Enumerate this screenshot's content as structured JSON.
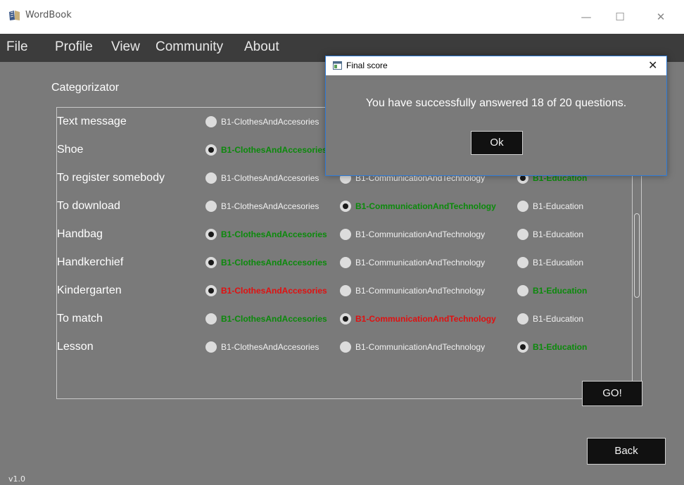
{
  "window": {
    "title": "WordBook",
    "minimize": "—",
    "maximize": "☐",
    "close": "✕"
  },
  "menu": [
    "File",
    "Profile",
    "View",
    "Community",
    "About"
  ],
  "section_title": "Categorizator",
  "categories": [
    "B1-ClothesAndAccesories",
    "B1-CommunicationAndTechnology",
    "B1-Education"
  ],
  "rows": [
    {
      "word": "Text message",
      "options": [
        {
          "label": "B1-ClothesAndAccesories",
          "selected": false,
          "state": "normal"
        },
        {
          "label": "B1-CommunicationAndTechnology",
          "selected": false,
          "state": "normal"
        },
        {
          "label": "B1-Education",
          "selected": false,
          "state": "normal"
        }
      ]
    },
    {
      "word": "Shoe",
      "options": [
        {
          "label": "B1-ClothesAndAccesories",
          "selected": true,
          "state": "correct"
        },
        {
          "label": "B1-CommunicationAndTechnology",
          "selected": false,
          "state": "normal"
        },
        {
          "label": "B1-Education",
          "selected": false,
          "state": "normal"
        }
      ]
    },
    {
      "word": "To register somebody",
      "options": [
        {
          "label": "B1-ClothesAndAccesories",
          "selected": false,
          "state": "normal"
        },
        {
          "label": "B1-CommunicationAndTechnology",
          "selected": false,
          "state": "normal"
        },
        {
          "label": "B1-Education",
          "selected": true,
          "state": "correct"
        }
      ]
    },
    {
      "word": "To download",
      "options": [
        {
          "label": "B1-ClothesAndAccesories",
          "selected": false,
          "state": "normal"
        },
        {
          "label": "B1-CommunicationAndTechnology",
          "selected": true,
          "state": "correct"
        },
        {
          "label": "B1-Education",
          "selected": false,
          "state": "normal"
        }
      ]
    },
    {
      "word": "Handbag",
      "options": [
        {
          "label": "B1-ClothesAndAccesories",
          "selected": true,
          "state": "correct"
        },
        {
          "label": "B1-CommunicationAndTechnology",
          "selected": false,
          "state": "normal"
        },
        {
          "label": "B1-Education",
          "selected": false,
          "state": "normal"
        }
      ]
    },
    {
      "word": "Handkerchief",
      "options": [
        {
          "label": "B1-ClothesAndAccesories",
          "selected": true,
          "state": "correct"
        },
        {
          "label": "B1-CommunicationAndTechnology",
          "selected": false,
          "state": "normal"
        },
        {
          "label": "B1-Education",
          "selected": false,
          "state": "normal"
        }
      ]
    },
    {
      "word": "Kindergarten",
      "options": [
        {
          "label": "B1-ClothesAndAccesories",
          "selected": true,
          "state": "wrong"
        },
        {
          "label": "B1-CommunicationAndTechnology",
          "selected": false,
          "state": "normal"
        },
        {
          "label": "B1-Education",
          "selected": false,
          "state": "correct"
        }
      ]
    },
    {
      "word": "To match",
      "options": [
        {
          "label": "B1-ClothesAndAccesories",
          "selected": false,
          "state": "correct"
        },
        {
          "label": "B1-CommunicationAndTechnology",
          "selected": true,
          "state": "wrong"
        },
        {
          "label": "B1-Education",
          "selected": false,
          "state": "normal"
        }
      ]
    },
    {
      "word": "Lesson",
      "options": [
        {
          "label": "B1-ClothesAndAccesories",
          "selected": false,
          "state": "normal"
        },
        {
          "label": "B1-CommunicationAndTechnology",
          "selected": false,
          "state": "normal"
        },
        {
          "label": "B1-Education",
          "selected": true,
          "state": "correct"
        }
      ]
    }
  ],
  "go_button": "GO!",
  "back_button": "Back",
  "version": "v1.0",
  "dialog": {
    "title": "Final score",
    "close": "✕",
    "message": "You have successfully answered 18 of 20 questions.",
    "ok_button": "Ok"
  },
  "colors": {
    "correct": "#0b8a0b",
    "wrong": "#e01010",
    "app_background": "#7a7a7a",
    "menubar": "#3c3c3c",
    "dialog_border": "#2d7ad6"
  }
}
